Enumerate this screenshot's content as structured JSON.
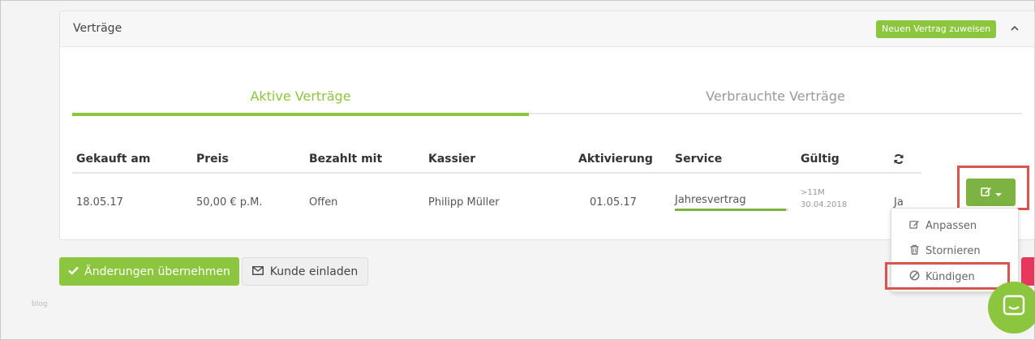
{
  "panel": {
    "title": "Verträge",
    "assign_button": "Neuen Vertrag zuweisen",
    "collapse_icon": "chevron-up-icon"
  },
  "tabs": [
    {
      "label": "Aktive Verträge",
      "active": true
    },
    {
      "label": "Verbrauchte Verträge",
      "active": false
    }
  ],
  "table": {
    "headers": {
      "purchased": "Gekauft am",
      "price": "Preis",
      "paid_with": "Bezahlt mit",
      "cashier": "Kassier",
      "activation": "Aktivierung",
      "service": "Service",
      "valid": "Gültig",
      "renew_icon": "refresh-icon"
    },
    "rows": [
      {
        "purchased": "18.05.17",
        "price": "50,00 € p.M.",
        "paid_with": "Offen",
        "cashier": "Philipp Müller",
        "activation": "01.05.17",
        "service": "Jahresvertrag",
        "service_progress": 0.98,
        "valid_remaining": ">11M",
        "valid_until": "30.04.2018",
        "renew": "Ja"
      }
    ]
  },
  "action_menu": {
    "button_icon": "edit-icon",
    "caret_icon": "caret-down-icon",
    "items": [
      {
        "label": "Anpassen",
        "icon": "edit-icon"
      },
      {
        "label": "Stornieren",
        "icon": "trash-icon"
      },
      {
        "label": "Kündigen",
        "icon": "ban-icon"
      }
    ]
  },
  "footer": {
    "apply_button": "Änderungen übernehmen",
    "invite_button": "Kunde einladen"
  },
  "watermark": "blog",
  "colors": {
    "accent": "#8cc63f",
    "accent_dark": "#7cb342",
    "highlight": "#d9534f",
    "danger": "#e8365d"
  }
}
